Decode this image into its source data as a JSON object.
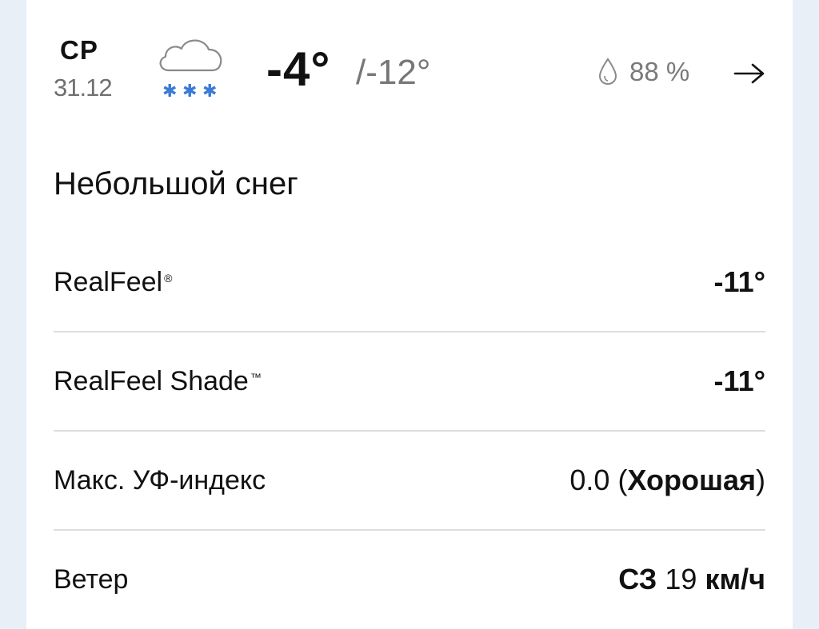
{
  "header": {
    "day": "СР",
    "date": "31.12",
    "icon": "light-snow-icon",
    "temp_high": "-4°",
    "temp_low": "/-12°",
    "humidity": "88 %"
  },
  "condition": "Небольшой снег",
  "details": [
    {
      "label": "RealFeel",
      "label_mark": "®",
      "value": "-11°"
    },
    {
      "label": "RealFeel Shade",
      "label_mark": "™",
      "value": "-11°"
    },
    {
      "label": "Макс. УФ-индекс",
      "value_main": "0.0 (",
      "value_bold": "Хорошая",
      "value_end": ")"
    },
    {
      "label": "Ветер",
      "value_dir": "СЗ",
      "value_speed": "19",
      "value_unit": "км/ч"
    }
  ],
  "colors": {
    "background": "#e9eff6",
    "card": "#ffffff",
    "snowflakes": "#3a7bd5",
    "muted": "#777777",
    "divider": "#dddddd"
  }
}
